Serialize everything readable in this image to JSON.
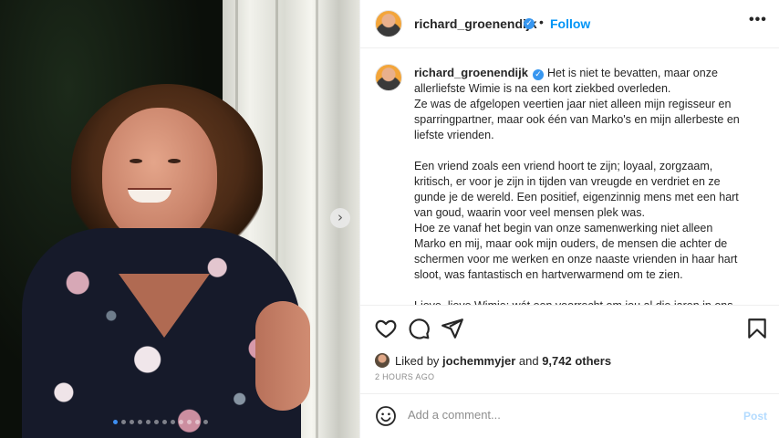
{
  "post": {
    "username": "richard_groenendijk",
    "follow_label": "Follow",
    "separator": "•",
    "more_icon": "•••",
    "caption_lines": "Het is niet te bevatten, maar onze\nallerliefste Wimie is na een kort ziekbed overleden.\nZe was de afgelopen veertien jaar niet alleen mijn regisseur en\nsparringpartner, maar ook één van Marko's en mijn allerbeste en\nliefste vrienden.\n\nEen vriend zoals een vriend hoort te zijn; loyaal, zorgzaam,\nkritisch, er voor je zijn in tijden van vreugde en verdriet en ze\ngunde je de wereld. Een positief, eigenzinnig mens met een hart\nvan goud, waarin voor veel mensen plek was.\nHoe ze vanaf het begin van onze samenwerking niet alleen\nMarko en mij, maar ook mijn ouders, de mensen die achter de\nschermen voor me werken en onze naaste vrienden in haar hart\nsloot, was fantastisch en hartverwarmend om te zien.\n\nLieve, lieve Wimie: wát een voorrecht om jou al die jaren in ons",
    "likes_prefix": "Liked by",
    "liked_by_user": "jochemmyjer",
    "likes_and": "and",
    "likes_others": "9,742 others",
    "time_ago": "2 HOURS AGO",
    "comment_placeholder": "Add a comment...",
    "post_label": "Post"
  },
  "carousel": {
    "next_glyph": "›",
    "slide_count": 12,
    "active_index": 0
  },
  "colors": {
    "accent": "#0095f6",
    "verified": "#3897f0",
    "post_disabled": "#b3dbff"
  },
  "icons": [
    "heart-icon",
    "comment-icon",
    "share-icon",
    "bookmark-icon",
    "emoji-icon",
    "verified-icon"
  ]
}
